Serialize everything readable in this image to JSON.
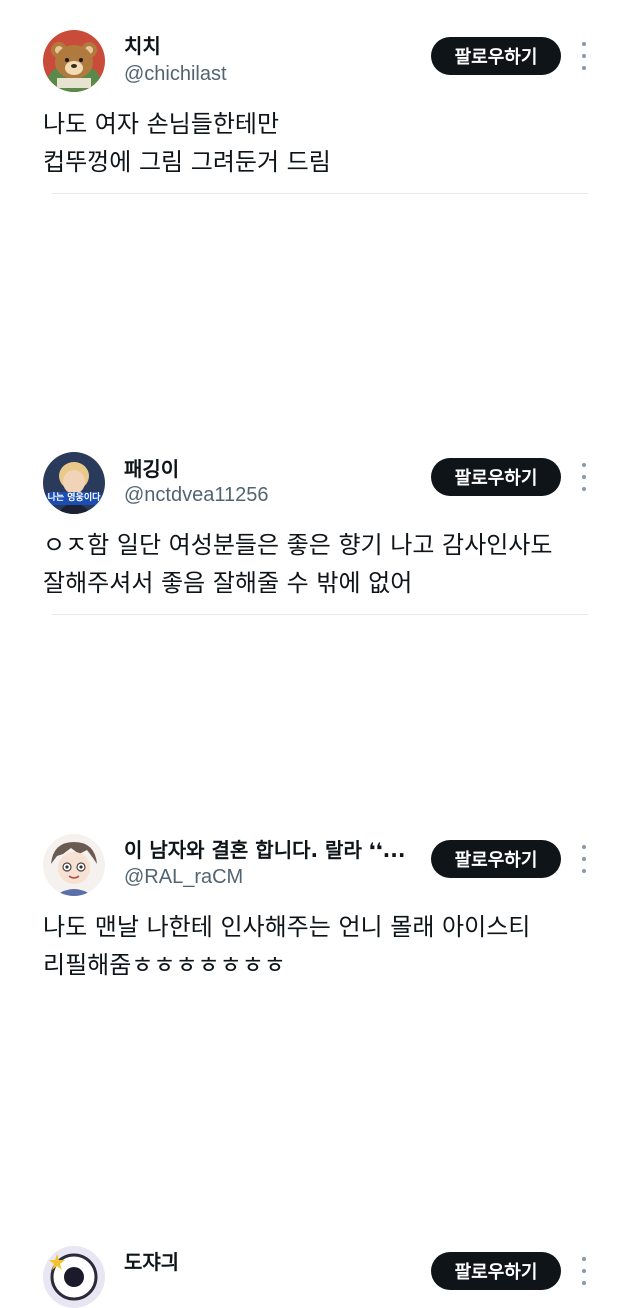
{
  "posts": [
    {
      "display_name": "치치",
      "handle": "@chichilast",
      "follow_label": "팔로우하기",
      "avatar_icon": "teddy-bear-avatar",
      "text_lines": [
        "나도 여자 손님들한테만",
        "컵뚜껑에 그림 그려둔거 드림"
      ]
    },
    {
      "display_name": "패깅이",
      "handle": "@nctdvea11256",
      "follow_label": "팔로우하기",
      "avatar_icon": "person-photo-avatar",
      "avatar_caption": "나는 영웅이다",
      "text_lines": [
        "ㅇㅈ함 일단 여성분들은 좋은 향기 나고 감사인사도",
        "잘해주셔서 좋음 잘해줄 수 밖에 없어"
      ]
    },
    {
      "display_name": "이 남자와 결혼 합니다. 랄라 ❛❛...",
      "handle": "@RAL_raCM",
      "follow_label": "팔로우하기",
      "avatar_icon": "anime-character-avatar",
      "text_lines": [
        "나도 맨날 나한테 인사해주는 언니 몰래 아이스티",
        "리필해줌ㅎㅎㅎㅎㅎㅎㅎ"
      ]
    },
    {
      "display_name": "도쟈긔",
      "follow_label": "팔로우하기",
      "avatar_icon": "star-character-avatar"
    }
  ],
  "colors": {
    "button_bg": "#0f1419",
    "handle": "#536471",
    "divider": "#e7e9ea"
  }
}
